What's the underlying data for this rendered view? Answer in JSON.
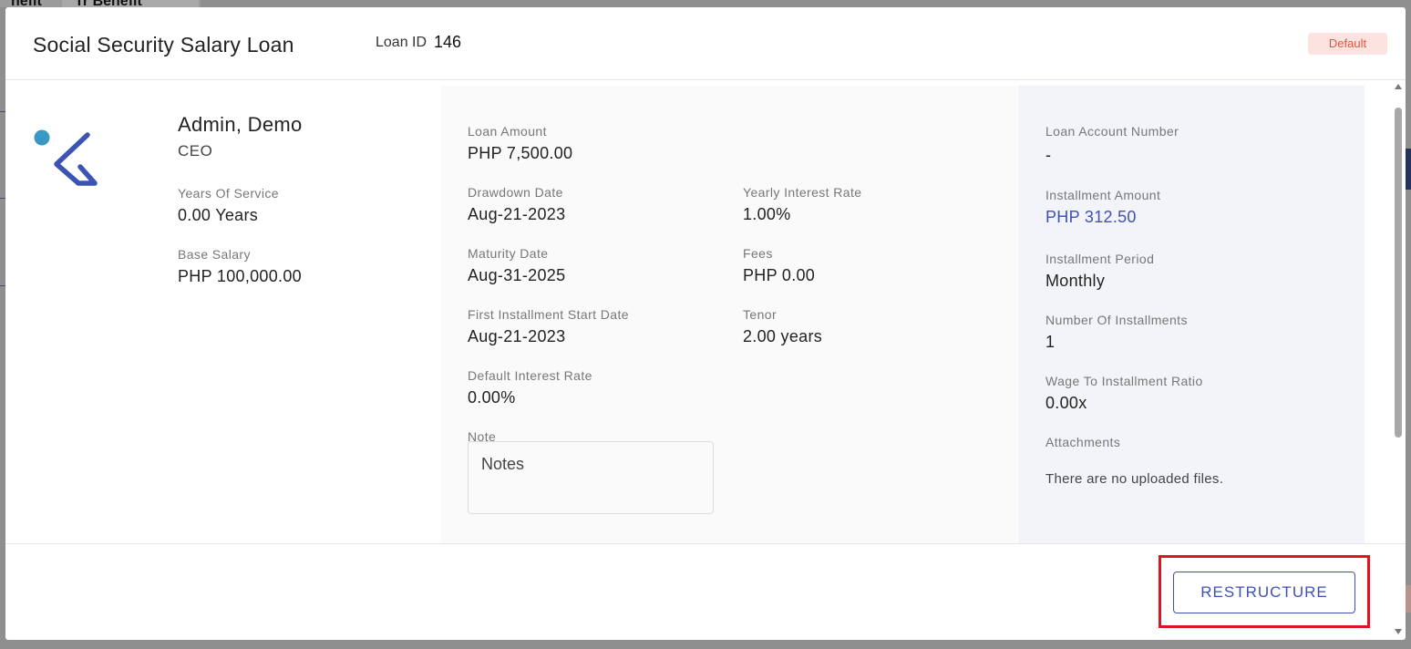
{
  "background": {
    "tab_partial_1": "nefit",
    "tab_partial_2": "Tr  Benefit"
  },
  "header": {
    "title": "Social Security Salary Loan",
    "loan_id_label": "Loan ID",
    "loan_id_value": "146",
    "status": "Default"
  },
  "employee": {
    "name": "Admin, Demo",
    "position": "CEO",
    "years_of_service_label": "Years Of Service",
    "years_of_service_value": "0.00 Years",
    "base_salary_label": "Base Salary",
    "base_salary_value": "PHP 100,000.00"
  },
  "loan": {
    "loan_amount_label": "Loan Amount",
    "loan_amount_value": "PHP 7,500.00",
    "drawdown_date_label": "Drawdown Date",
    "drawdown_date_value": "Aug-21-2023",
    "maturity_date_label": "Maturity Date",
    "maturity_date_value": "Aug-31-2025",
    "first_installment_label": "First Installment Start Date",
    "first_installment_value": "Aug-21-2023",
    "default_interest_label": "Default Interest Rate",
    "default_interest_value": "0.00%",
    "yearly_interest_label": "Yearly Interest Rate",
    "yearly_interest_value": "1.00%",
    "fees_label": "Fees",
    "fees_value": "PHP 0.00",
    "tenor_label": "Tenor",
    "tenor_value": "2.00 years",
    "note_label": "Note",
    "note_placeholder": "Notes"
  },
  "account": {
    "account_number_label": "Loan Account Number",
    "account_number_value": "-",
    "installment_amount_label": "Installment Amount",
    "installment_amount_value": "PHP 312.50",
    "installment_period_label": "Installment Period",
    "installment_period_value": "Monthly",
    "number_of_installments_label": "Number Of Installments",
    "number_of_installments_value": "1",
    "wage_ratio_label": "Wage To Installment Ratio",
    "wage_ratio_value": "0.00x",
    "attachments_label": "Attachments",
    "attachments_empty": "There are no uploaded files."
  },
  "footer": {
    "restructure_label": "RESTRUCTURE"
  },
  "colors": {
    "accent": "#3f51b5",
    "status_bg": "#fde3df",
    "status_text": "#e2553b",
    "highlight": "#e0141e"
  },
  "icons": {
    "logo": "company-logo-icon",
    "scroll_up": "chevron-up-icon",
    "scroll_down": "chevron-down-icon"
  }
}
